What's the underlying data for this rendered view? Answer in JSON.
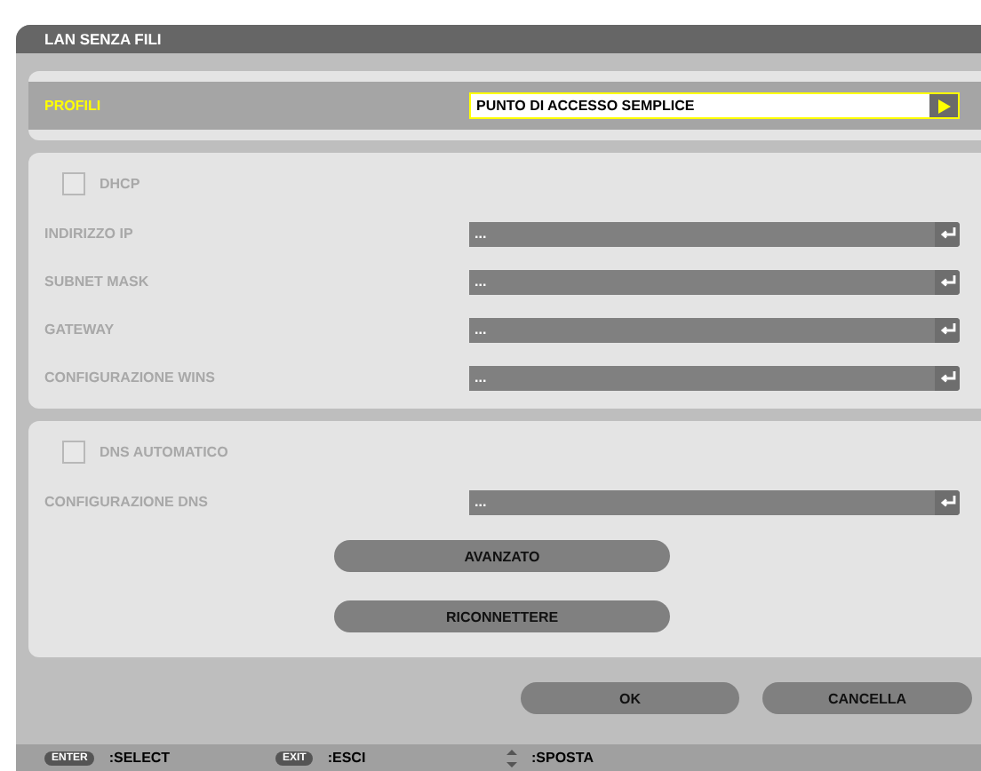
{
  "window": {
    "title": "LAN SENZA FILI"
  },
  "profile": {
    "label": "PROFILI",
    "value": "PUNTO DI ACCESSO SEMPLICE",
    "selected": true
  },
  "ip_section": {
    "checkbox": {
      "label": "DHCP",
      "checked": false,
      "disabled": true
    },
    "fields": [
      {
        "label": "INDIRIZZO IP",
        "value": "...",
        "disabled": true
      },
      {
        "label": "SUBNET MASK",
        "value": "...",
        "disabled": true
      },
      {
        "label": "GATEWAY",
        "value": "...",
        "disabled": true
      },
      {
        "label": "CONFIGURAZIONE WINS",
        "value": "...",
        "disabled": true
      }
    ]
  },
  "dns_section": {
    "checkbox": {
      "label": "DNS AUTOMATICO",
      "checked": false,
      "disabled": true
    },
    "fields": [
      {
        "label": "CONFIGURAZIONE DNS",
        "value": "...",
        "disabled": true
      }
    ],
    "buttons": [
      "AVANZATO",
      "RICONNETTERE"
    ]
  },
  "dialog_buttons": [
    "OK",
    "CANCELLA"
  ],
  "footer": [
    {
      "key": "ENTER",
      "action": ":SELECT",
      "kind": "badge"
    },
    {
      "key": "EXIT",
      "action": ":ESCI",
      "kind": "badge"
    },
    {
      "action": ":SPOSTA",
      "kind": "arrows"
    }
  ]
}
